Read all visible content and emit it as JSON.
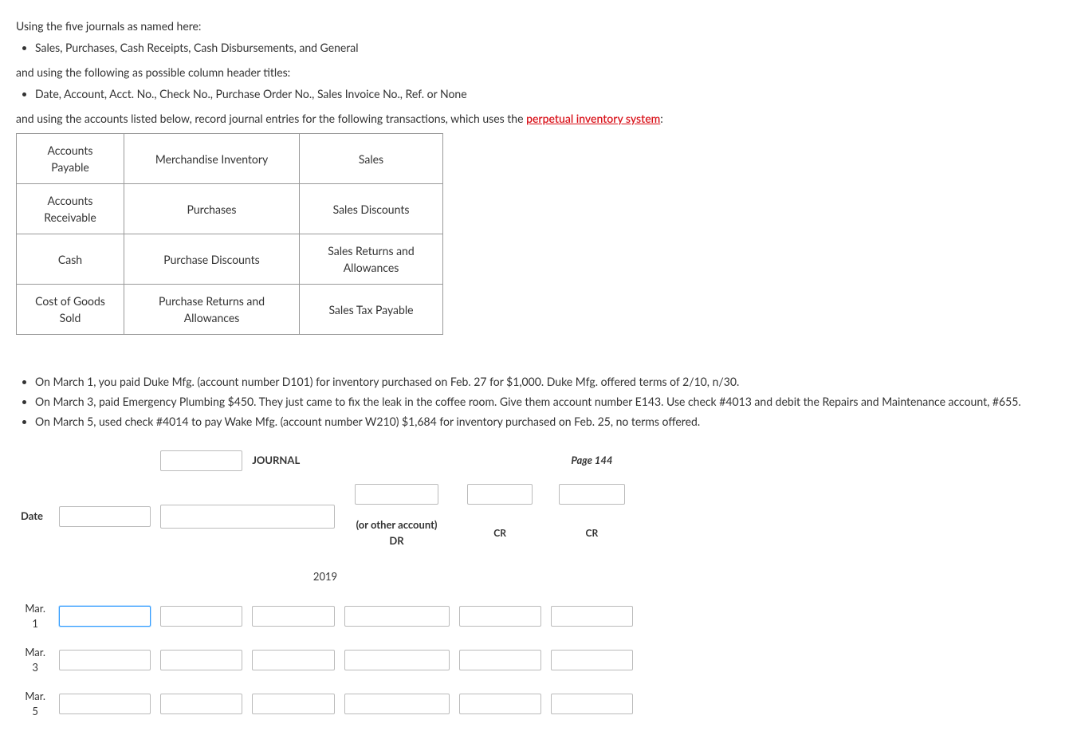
{
  "intro": {
    "line1": "Using the five journals as named here:",
    "bullet1": "Sales, Purchases, Cash Receipts, Cash Disbursements, and General",
    "line2": "and using the following as possible column header titles:",
    "bullet2": "Date, Account, Acct. No., Check No., Purchase Order No., Sales Invoice No., Ref. or None",
    "line3_pre": "and using the accounts listed below, record journal entries for the following transactions, which uses the ",
    "line3_link": "perpetual inventory system",
    "line3_post": ":"
  },
  "accounts_table": {
    "rows": [
      [
        "Accounts Payable",
        "Merchandise Inventory",
        "Sales"
      ],
      [
        "Accounts Receivable",
        "Purchases",
        "Sales Discounts"
      ],
      [
        "Cash",
        "Purchase Discounts",
        "Sales Returns and Allowances"
      ],
      [
        "Cost of Goods Sold",
        "Purchase Returns and Allowances",
        "Sales Tax Payable"
      ]
    ]
  },
  "transactions": [
    "On March 1, you paid Duke Mfg. (account number D101) for inventory purchased on Feb. 27 for $1,000. Duke Mfg. offered terms of 2/10, n/30.",
    "On March 3, paid Emergency Plumbing $450. They just came to fix the leak in the coffee room. Give them account number E143. Use check #4013 and debit the Repairs and Maintenance account, #655.",
    "On March 5, used check #4014 to pay Wake Mfg. (account number W210) $1,684 for inventory purchased on Feb. 25, no terms offered."
  ],
  "journal": {
    "title_label": "JOURNAL",
    "page_label": "Page 144",
    "header": {
      "date": "Date",
      "other_account_dr_line1": "(or other account)",
      "other_account_dr_line2": "DR",
      "cr1": "CR",
      "cr2": "CR"
    },
    "year": "2019",
    "rows": [
      {
        "date": "Mar. 1"
      },
      {
        "date": "Mar. 3"
      },
      {
        "date": "Mar. 5"
      }
    ]
  }
}
